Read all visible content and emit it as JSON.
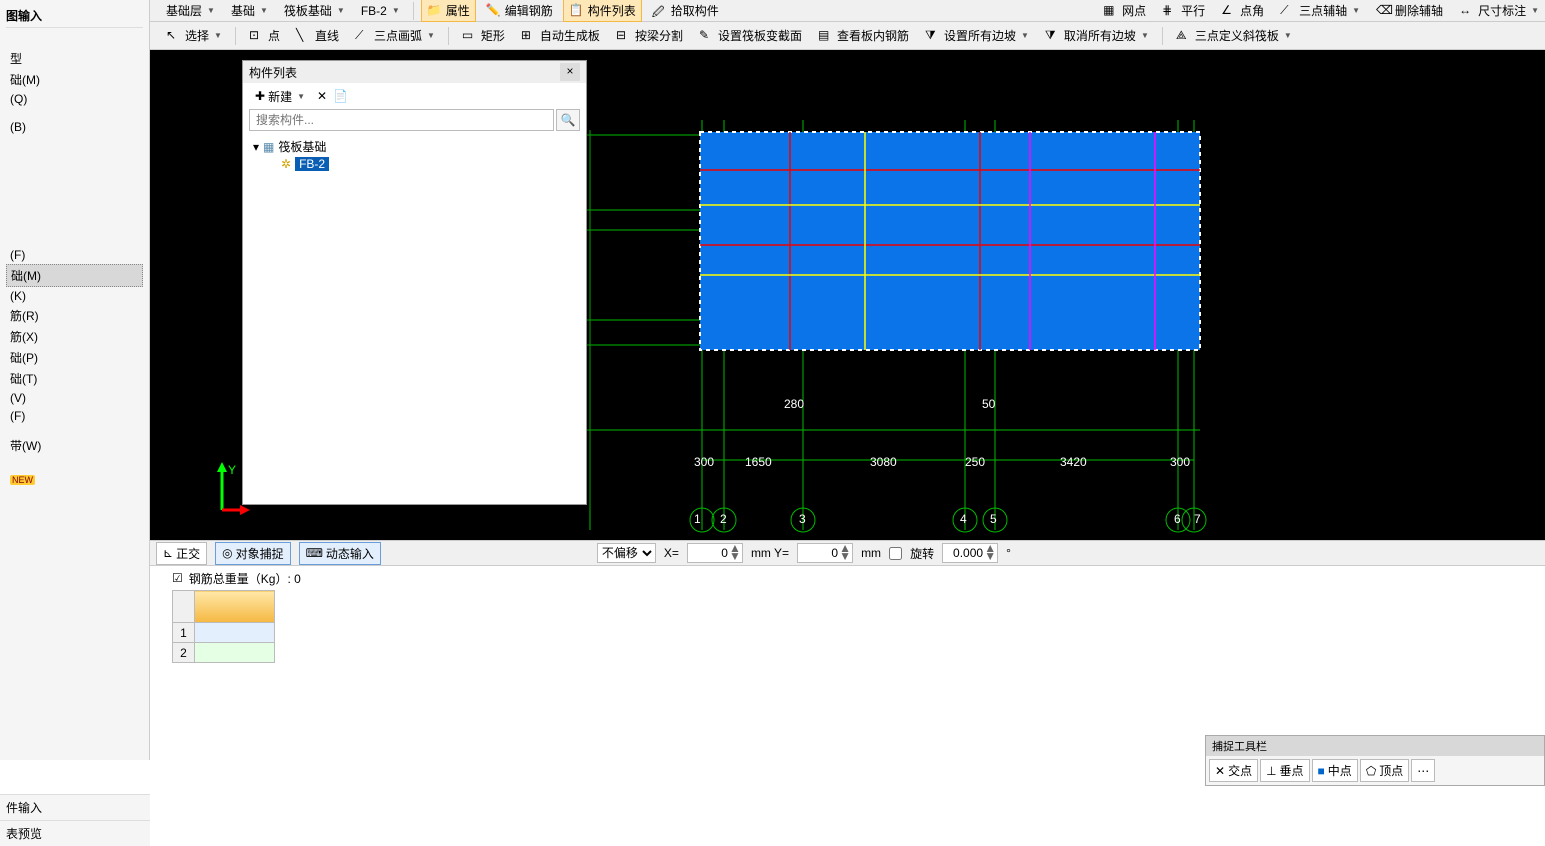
{
  "left": {
    "header": "图输入",
    "group1_header": "型",
    "items1": [
      "础(M)",
      "(Q)",
      "(B)"
    ],
    "items2": [
      "(F)",
      "础(M)",
      "(K)",
      "筋(R)",
      "筋(X)",
      "础(P)",
      "础(T)",
      "(V)",
      "(F)"
    ],
    "items3": [
      "带(W)"
    ],
    "new_label": "NEW",
    "bottom1": "件输入",
    "bottom2": "表预览"
  },
  "toolbar1": {
    "layer": "基础层",
    "cat": "基础",
    "type": "筏板基础",
    "item": "FB-2",
    "attrs": "属性",
    "edit_rebar": "编辑钢筋",
    "component_list": "构件列表",
    "pick": "拾取构件",
    "grid": "网点",
    "parallel": "平行",
    "endpoint": "点角",
    "three_point_aux": "三点辅轴",
    "del_aux": "删除辅轴",
    "dim": "尺寸标注"
  },
  "toolbar2": {
    "select": "选择",
    "point": "点",
    "line": "直线",
    "arc": "三点画弧",
    "rect": "矩形",
    "auto_plate": "自动生成板",
    "split_beam": "按梁分割",
    "set_raft_section": "设置筏板变截面",
    "view_rebar": "查看板内钢筋",
    "set_slope": "设置所有边坡",
    "cancel_slope": "取消所有边坡",
    "three_point_raft": "三点定义斜筏板"
  },
  "float": {
    "title": "构件列表",
    "new": "新建",
    "search_ph": "搜索构件...",
    "root": "筏板基础",
    "leaf": "FB-2"
  },
  "dims": {
    "top_labels": [
      "280",
      "50"
    ],
    "bottom_labels": [
      "300",
      "1650",
      "3080",
      "250",
      "3420",
      "300"
    ],
    "axis_labels": [
      "1",
      "2",
      "3",
      "4",
      "5",
      "6",
      "7"
    ]
  },
  "status": {
    "ortho": "正交",
    "osnap": "对象捕捉",
    "dyn_input": "动态输入",
    "offset": "不偏移",
    "x_label": "X=",
    "x_val": "0",
    "y_label": "mm Y=",
    "y_val": "0",
    "mm": "mm",
    "rotate": "旋转",
    "rot_val": "0.000"
  },
  "info": {
    "rebar_weight": "钢筋总重量（Kg）: 0"
  },
  "grid": {
    "r1": "1",
    "r2": "2"
  },
  "snap": {
    "title": "捕捉工具栏",
    "intersect": "交点",
    "perp": "垂点",
    "mid": "中点",
    "apex": "顶点"
  }
}
